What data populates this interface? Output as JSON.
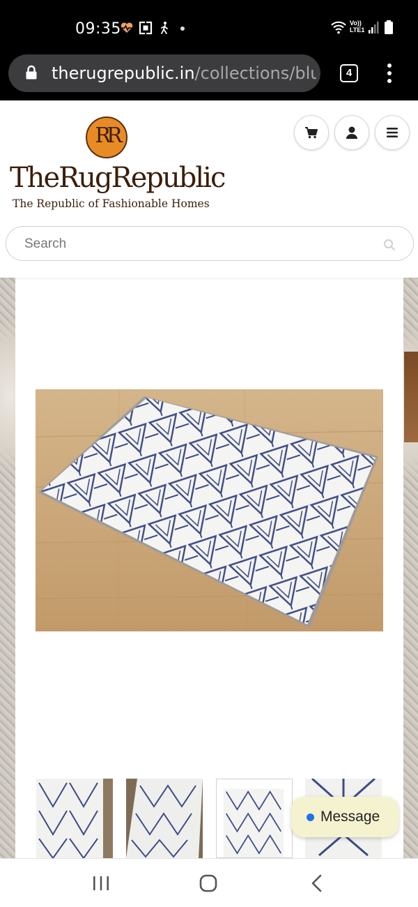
{
  "status_bar": {
    "time": "09:35",
    "icons_left": [
      "heart-rate-icon",
      "screenshot-icon",
      "walking-icon",
      "notification-dot-icon"
    ],
    "icons_right": [
      "wifi-icon",
      "volte-lte-icon",
      "signal-icon",
      "battery-icon"
    ],
    "network_label": "Vo)) LTE1"
  },
  "browser": {
    "url_host": "therugrepublic.in",
    "url_path": "/collections/blu",
    "tab_count": "4"
  },
  "site": {
    "logo_monogram": "RR",
    "logo_name": "TheRugRepublic",
    "logo_tagline": "The Republic of Fashionable Homes",
    "brand_color": "#e98b25",
    "header_icons": [
      "cart-icon",
      "account-icon",
      "menu-icon"
    ],
    "search_placeholder": "Search"
  },
  "product": {
    "main_image": "geometric-blue-white-rug-photo",
    "rug_colors": {
      "base": "#f3f3f1",
      "pattern": "#3d4a86",
      "floor": "#c9a67a"
    },
    "thumbnails": [
      {
        "name": "rug-thumbnail-1",
        "selected": false
      },
      {
        "name": "rug-thumbnail-2",
        "selected": false
      },
      {
        "name": "rug-thumbnail-3",
        "selected": true
      },
      {
        "name": "rug-thumbnail-4",
        "selected": false
      }
    ]
  },
  "chat": {
    "label": "Message",
    "dot_color": "#1f73e6"
  },
  "nav_bar": {
    "buttons": [
      "recent-apps-icon",
      "home-icon",
      "back-icon"
    ]
  }
}
